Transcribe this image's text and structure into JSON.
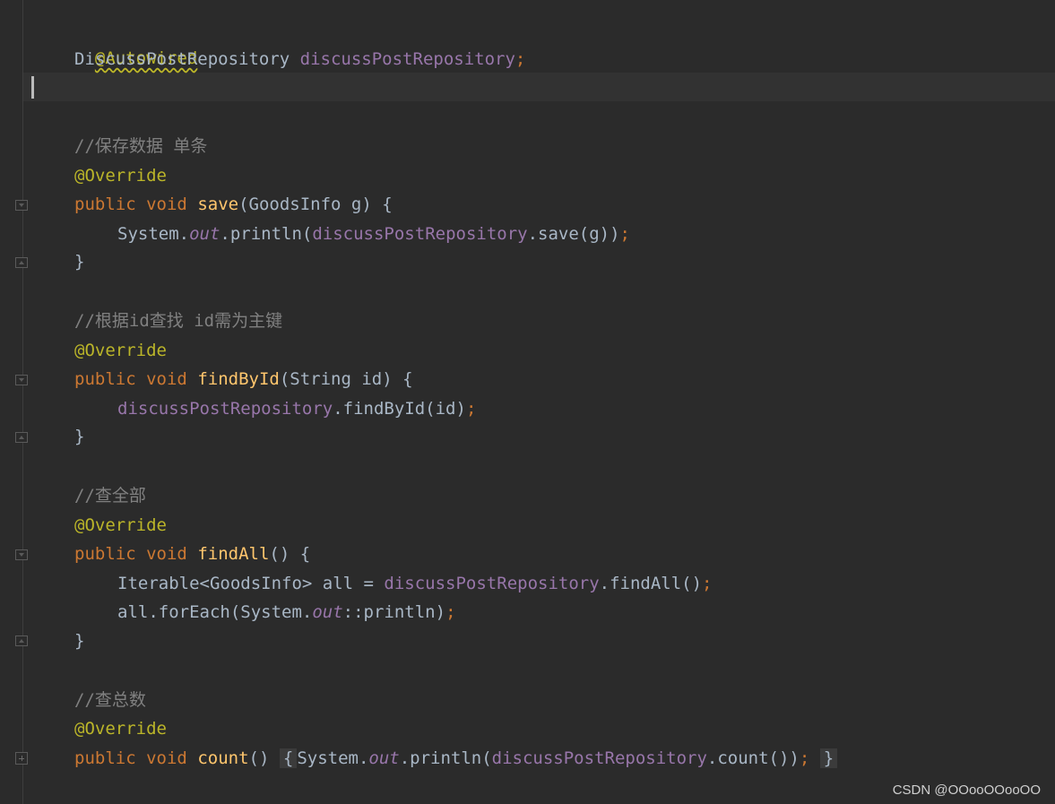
{
  "code": {
    "l1_annotation": "@Autowired",
    "l2_type": "DiscussPostRepository",
    "l2_field": "discussPostRepository",
    "semicolon": ";",
    "c1_comment": "//保存数据 单条",
    "override": "@Override",
    "public": "public",
    "void": "void",
    "save_name": "save",
    "save_params": "(GoodsInfo g) {",
    "save_body_a": "System.",
    "out": "out",
    "save_body_b": ".println(",
    "field": "discussPostRepository",
    "save_body_c": ".save(g))",
    "close_brace": "}",
    "c2_comment": "//根据id查找 id需为主键",
    "findbyid_name": "findById",
    "findbyid_params": "(String id) {",
    "findbyid_body": ".findById(id)",
    "c3_comment": "//查全部",
    "findall_name": "findAll",
    "findall_params": "() {",
    "findall_body1_a": "Iterable<GoodsInfo> all = ",
    "findall_body1_b": ".findAll()",
    "findall_body2_a": "all.forEach(System.",
    "findall_body2_b": "::println)",
    "c4_comment": "//查总数",
    "count_name": "count",
    "count_parens": "()",
    "open_brace": "{",
    "count_body_a": "System.",
    "count_body_b": ".println(",
    "count_body_c": ".count())"
  },
  "watermark": "CSDN @OOooOOooOO"
}
